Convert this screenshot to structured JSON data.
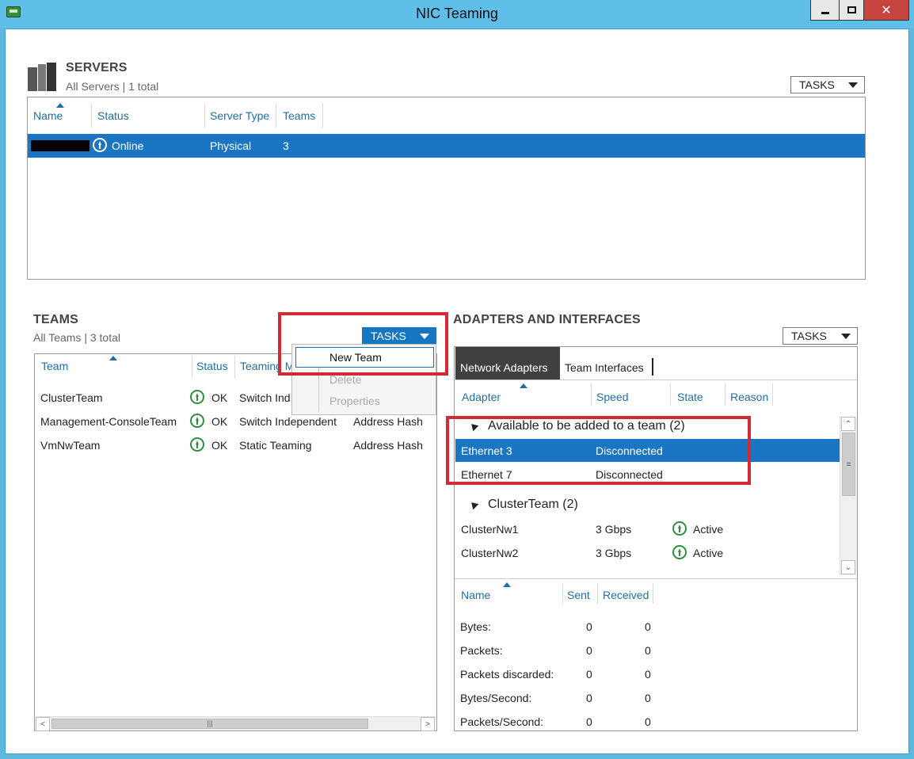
{
  "window": {
    "title": "NIC Teaming"
  },
  "servers": {
    "title": "SERVERS",
    "subtitle": "All Servers | 1 total",
    "tasks_label": "TASKS",
    "columns": [
      "Name",
      "Status",
      "Server Type",
      "Teams"
    ],
    "row": {
      "status": "Online",
      "type": "Physical",
      "teams": "3"
    }
  },
  "teams": {
    "title": "TEAMS",
    "subtitle": "All Teams | 3 total",
    "tasks_label": "TASKS",
    "columns": [
      "Team",
      "Status",
      "Teaming M"
    ],
    "rows": [
      {
        "team": "ClusterTeam",
        "status": "OK",
        "mode": "Switch Ind",
        "lb": ""
      },
      {
        "team": "Management-ConsoleTeam",
        "status": "OK",
        "mode": "Switch Independent",
        "lb": "Address Hash"
      },
      {
        "team": "VmNwTeam",
        "status": "OK",
        "mode": "Static Teaming",
        "lb": "Address Hash"
      }
    ],
    "menu": [
      "New Team",
      "Delete",
      "Properties"
    ]
  },
  "adapters": {
    "title": "ADAPTERS AND INTERFACES",
    "tasks_label": "TASKS",
    "tabs": [
      "Network Adapters",
      "Team Interfaces"
    ],
    "columns": [
      "Adapter",
      "Speed",
      "State",
      "Reason"
    ],
    "group1": {
      "label": "Available to be added to a team (2)",
      "rows": [
        {
          "name": "Ethernet 3",
          "speed": "Disconnected"
        },
        {
          "name": "Ethernet 7",
          "speed": "Disconnected"
        }
      ]
    },
    "group2": {
      "label": "ClusterTeam (2)",
      "rows": [
        {
          "name": "ClusterNw1",
          "speed": "3 Gbps",
          "state": "Active"
        },
        {
          "name": "ClusterNw2",
          "speed": "3 Gbps",
          "state": "Active"
        }
      ]
    }
  },
  "stats": {
    "columns": [
      "Name",
      "Sent",
      "Received"
    ],
    "rows": [
      {
        "name": "Bytes:",
        "sent": "0",
        "received": "0"
      },
      {
        "name": "Packets:",
        "sent": "0",
        "received": "0"
      },
      {
        "name": "Packets discarded:",
        "sent": "0",
        "received": "0"
      },
      {
        "name": "Bytes/Second:",
        "sent": "0",
        "received": "0"
      },
      {
        "name": "Packets/Second:",
        "sent": "0",
        "received": "0"
      }
    ]
  },
  "icons": [
    "app-icon",
    "servers-icon",
    "status-up-icon",
    "sort-up-icon",
    "dropdown-caret-icon",
    "expand-triangle-icon"
  ],
  "colors": {
    "selection": "#1a75c3",
    "header_text": "#1e6fa8",
    "highlight_box": "#d22b35",
    "ok_green": "#2f8f3f"
  }
}
